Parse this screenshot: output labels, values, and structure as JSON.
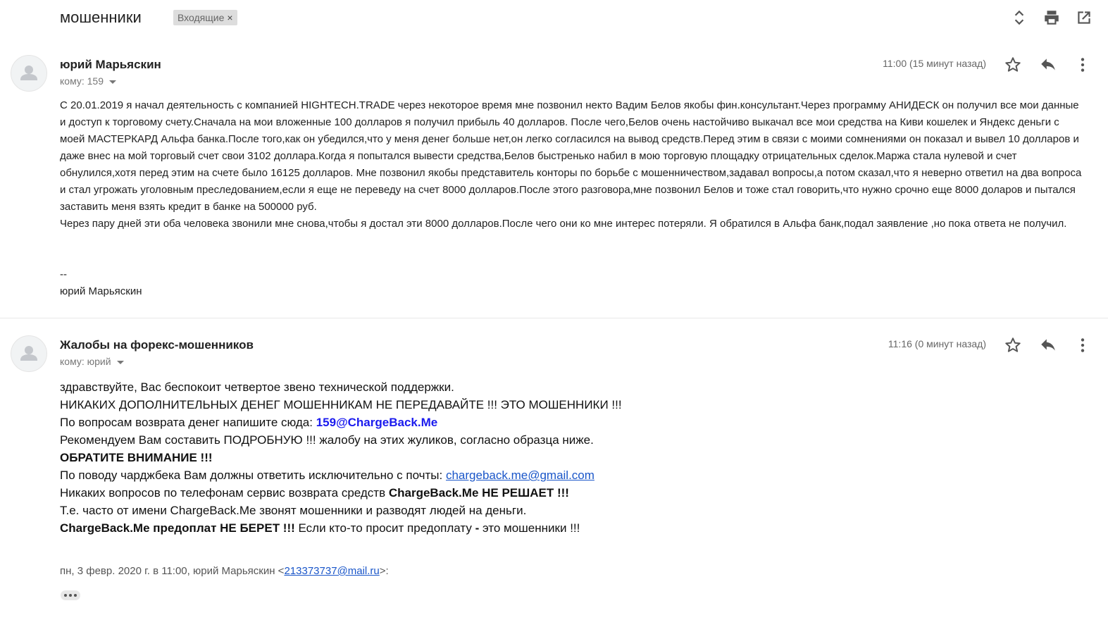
{
  "header": {
    "subject": "мошенники",
    "label": "Входящие",
    "label_close": "×"
  },
  "messages": [
    {
      "sender": "юрий Марьяскин",
      "to": "кому: 159",
      "time": "11:00 (15 минут назад)",
      "body": [
        "С 20.01.2019 я начал деятельность с компанией HIGHTECH.TRADE через некоторое время мне позвонил некто Вадим Белов якобы фин.консультант.Через программу АНИДЕСК он получил все мои данные и доступ к торговому счету.Сначала на мои вложенные 100 долларов я получил прибыль 40 долларов. После чего,Белов очень настойчиво выкачал все мои средства на Киви кошелек и Яндекс деньги с моей МАСТЕРКАРД Альфа банка.После того,как он убедился,что у меня денег больше нет,он легко согласился на вывод средств.Перед этим в связи с моими сомнениями он показал и вывел 10 долларов и даже внес на мой торговый счет свои 3102 доллара.Когда я попытался вывести средства,Белов быстренько набил в мою торговую площадку отрицательных сделок.Маржа стала нулевой и счет обнулился,хотя перед этим на счете было 16125 долларов. Мне позвонил якобы представитель конторы по борьбе с мошенничеством,задавал вопросы,а потом сказал,что я неверно ответил на два вопроса и стал угрожать уголовным преследованием,если я еще не переведу на счет 8000 долларов.После этого разговора,мне позвонил Белов и тоже стал говорить,что нужно срочно еще 8000 доларов и пытался заставить меня взять кредит в банке на 500000 руб.",
        "Через пару дней эти оба человека звонили мне снова,чтобы я достал эти 8000 долларов.После чего они ко мне интерес потеряли. Я обратился в Альфа банк,подал заявление ,но пока ответа не получил."
      ],
      "sig_dash": "--",
      "sig_name": "юрий Марьяскин"
    },
    {
      "sender": "Жалобы на форекс-мошенников",
      "to": "кому: юрий",
      "time": "11:16 (0 минут назад)",
      "lines": {
        "l1": "здравствуйте, Вас беспокоит четвертое звено технической поддержки.",
        "l2": "НИКАКИХ ДОПОЛНИТЕЛЬНЫХ ДЕНЕГ МОШЕННИКАМ НЕ ПЕРЕДАВАЙТЕ !!! ЭТО МОШЕННИКИ !!!",
        "l3_text": "По вопросам возврата денег напишите сюда: ",
        "l3_email": "159@ChargeBack.Me",
        "l4": "Рекомендуем Вам составить ПОДРОБНУЮ !!! жалобу на этих жуликов, согласно образца ниже.",
        "l5": "ОБРАТИТЕ ВНИМАНИЕ !!!",
        "l6_text": "По поводу чарджбека Вам должны ответить исключительно с почты: ",
        "l6_link": "chargeback.me@gmail.com",
        "l7_text": "Никаких вопросов по телефонам сервис возврата средств ",
        "l7_bold": "ChargeBack.Me НЕ РЕШАЕТ !!!",
        "l8": "Т.е. часто от имени ChargeBack.Me звонят мошенники и разводят людей на деньги.",
        "l9_bold": "ChargeBack.Me предоплат НЕ БЕРЕТ !!!",
        "l9_text": " Если кто-то просит предоплату ",
        "l9_dash": "-",
        "l9_end": " это мошенники !!!"
      },
      "quote_prefix": "пн, 3 февр. 2020 г. в 11:00, юрий Марьяскин <",
      "quote_email": "213373737@mail.ru",
      "quote_suffix": ">:"
    }
  ],
  "icons": {
    "expand": "unfold-icon",
    "print": "print-icon",
    "popout": "open-in-new-icon",
    "star": "star-icon",
    "reply": "reply-icon",
    "more": "more-vert-icon",
    "avatar": "person-icon"
  }
}
